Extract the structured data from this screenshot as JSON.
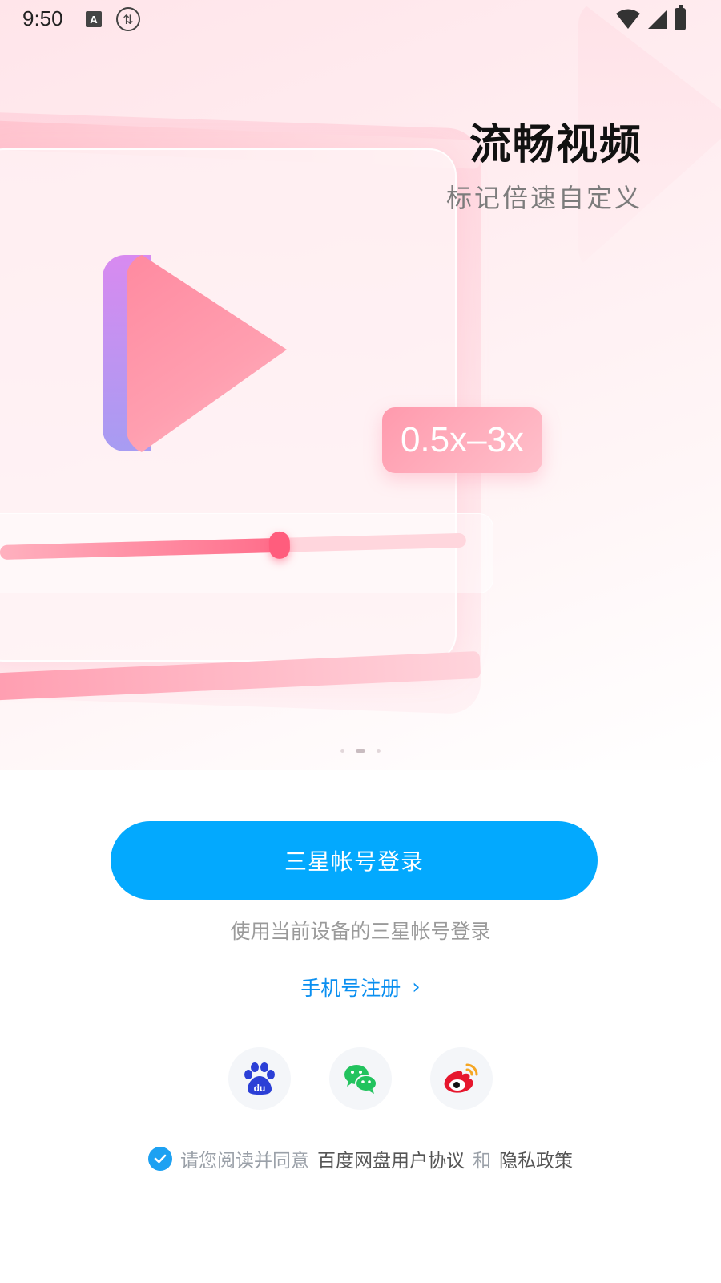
{
  "status_bar": {
    "time": "9:50",
    "icons": [
      "a-notification-icon",
      "sync-icon",
      "wifi-icon",
      "signal-icon",
      "battery-icon"
    ]
  },
  "hero": {
    "title": "流畅视频",
    "subtitle": "标记倍速自定义",
    "speed_badge": "0.5x–3x",
    "slider_progress": 0.6,
    "pager": {
      "count": 3,
      "active_index": 1
    }
  },
  "login": {
    "primary_button": "三星帐号登录",
    "hint": "使用当前设备的三星帐号登录",
    "phone_register": "手机号注册",
    "socials": [
      {
        "name": "baidu",
        "icon": "baidu-paw-icon"
      },
      {
        "name": "wechat",
        "icon": "wechat-icon"
      },
      {
        "name": "weibo",
        "icon": "weibo-icon"
      }
    ]
  },
  "agreement": {
    "checked": true,
    "prefix": "请您阅读并同意",
    "user_agreement": "百度网盘用户协议",
    "conjunction": "和",
    "privacy_policy": "隐私政策"
  },
  "colors": {
    "primary": "#03a9fe",
    "link": "#0a8ff0",
    "hero_pink": "#ff8aa0"
  }
}
